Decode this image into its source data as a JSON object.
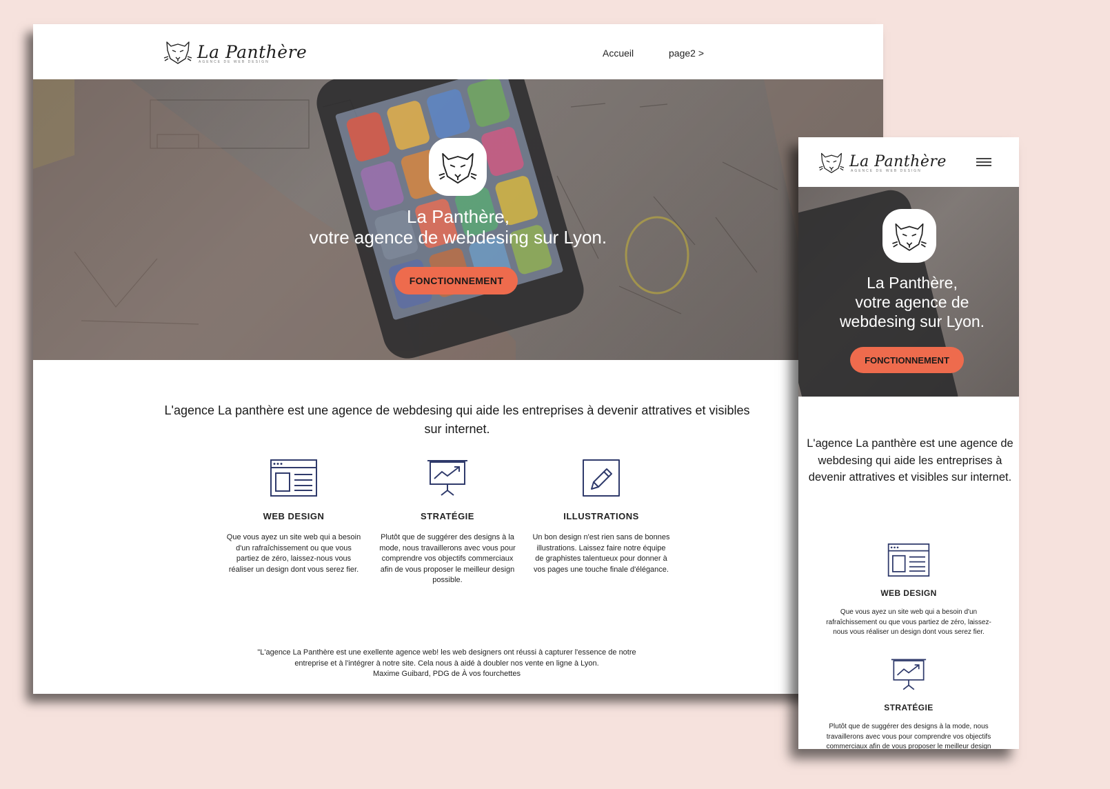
{
  "brand": {
    "name": "La Panthère",
    "tagline": "AGENCE DE WEB DESIGN"
  },
  "nav": {
    "items": [
      {
        "label": "Accueil"
      },
      {
        "label": "page2 >"
      }
    ]
  },
  "hero": {
    "title_line1": "La Panthère,",
    "title_line2": "votre agence de webdesing sur Lyon.",
    "cta_label": "FONCTIONNEMENT"
  },
  "intro": "L'agence La panthère est une agence de webdesing qui aide les entreprises à devenir attratives et visibles sur internet.",
  "services": [
    {
      "icon": "browser-window-icon",
      "title": "WEB DESIGN",
      "text": "Que vous ayez un site web qui a besoin d'un rafraîchissement ou que vous partiez de zéro, laissez-nous vous réaliser un design dont vous serez fier."
    },
    {
      "icon": "presentation-chart-icon",
      "title": "STRATÉGIE",
      "text": "Plutôt que de suggérer des designs à la mode, nous travaillerons avec vous pour comprendre vos objectifs commerciaux afin de vous proposer le meilleur design possible."
    },
    {
      "icon": "pencil-square-icon",
      "title": "ILLUSTRATIONS",
      "text": "Un bon design n'est rien sans de bonnes illustrations. Laissez faire notre équipe de graphistes talentueux pour donner à vos pages une touche finale d'élégance."
    }
  ],
  "testimonial": {
    "quote_line1": "\"L'agence La Panthère est une exellente agence web! les web designers ont réussi à capturer l'essence de notre",
    "quote_line2": "entreprise et à l'intégrer à notre site. Cela nous à aidé à doubler nos vente en ligne à Lyon.",
    "author": "Maxime Guibard, PDG de À vos fourchettes"
  },
  "mobile": {
    "hero_title_line1": "La Panthère,",
    "hero_title_line2": "votre agence de",
    "hero_title_line3": "webdesing sur Lyon."
  },
  "colors": {
    "background": "#f6e2dd",
    "accent": "#ee6b4d",
    "icon_stroke": "#2f3a6b"
  }
}
